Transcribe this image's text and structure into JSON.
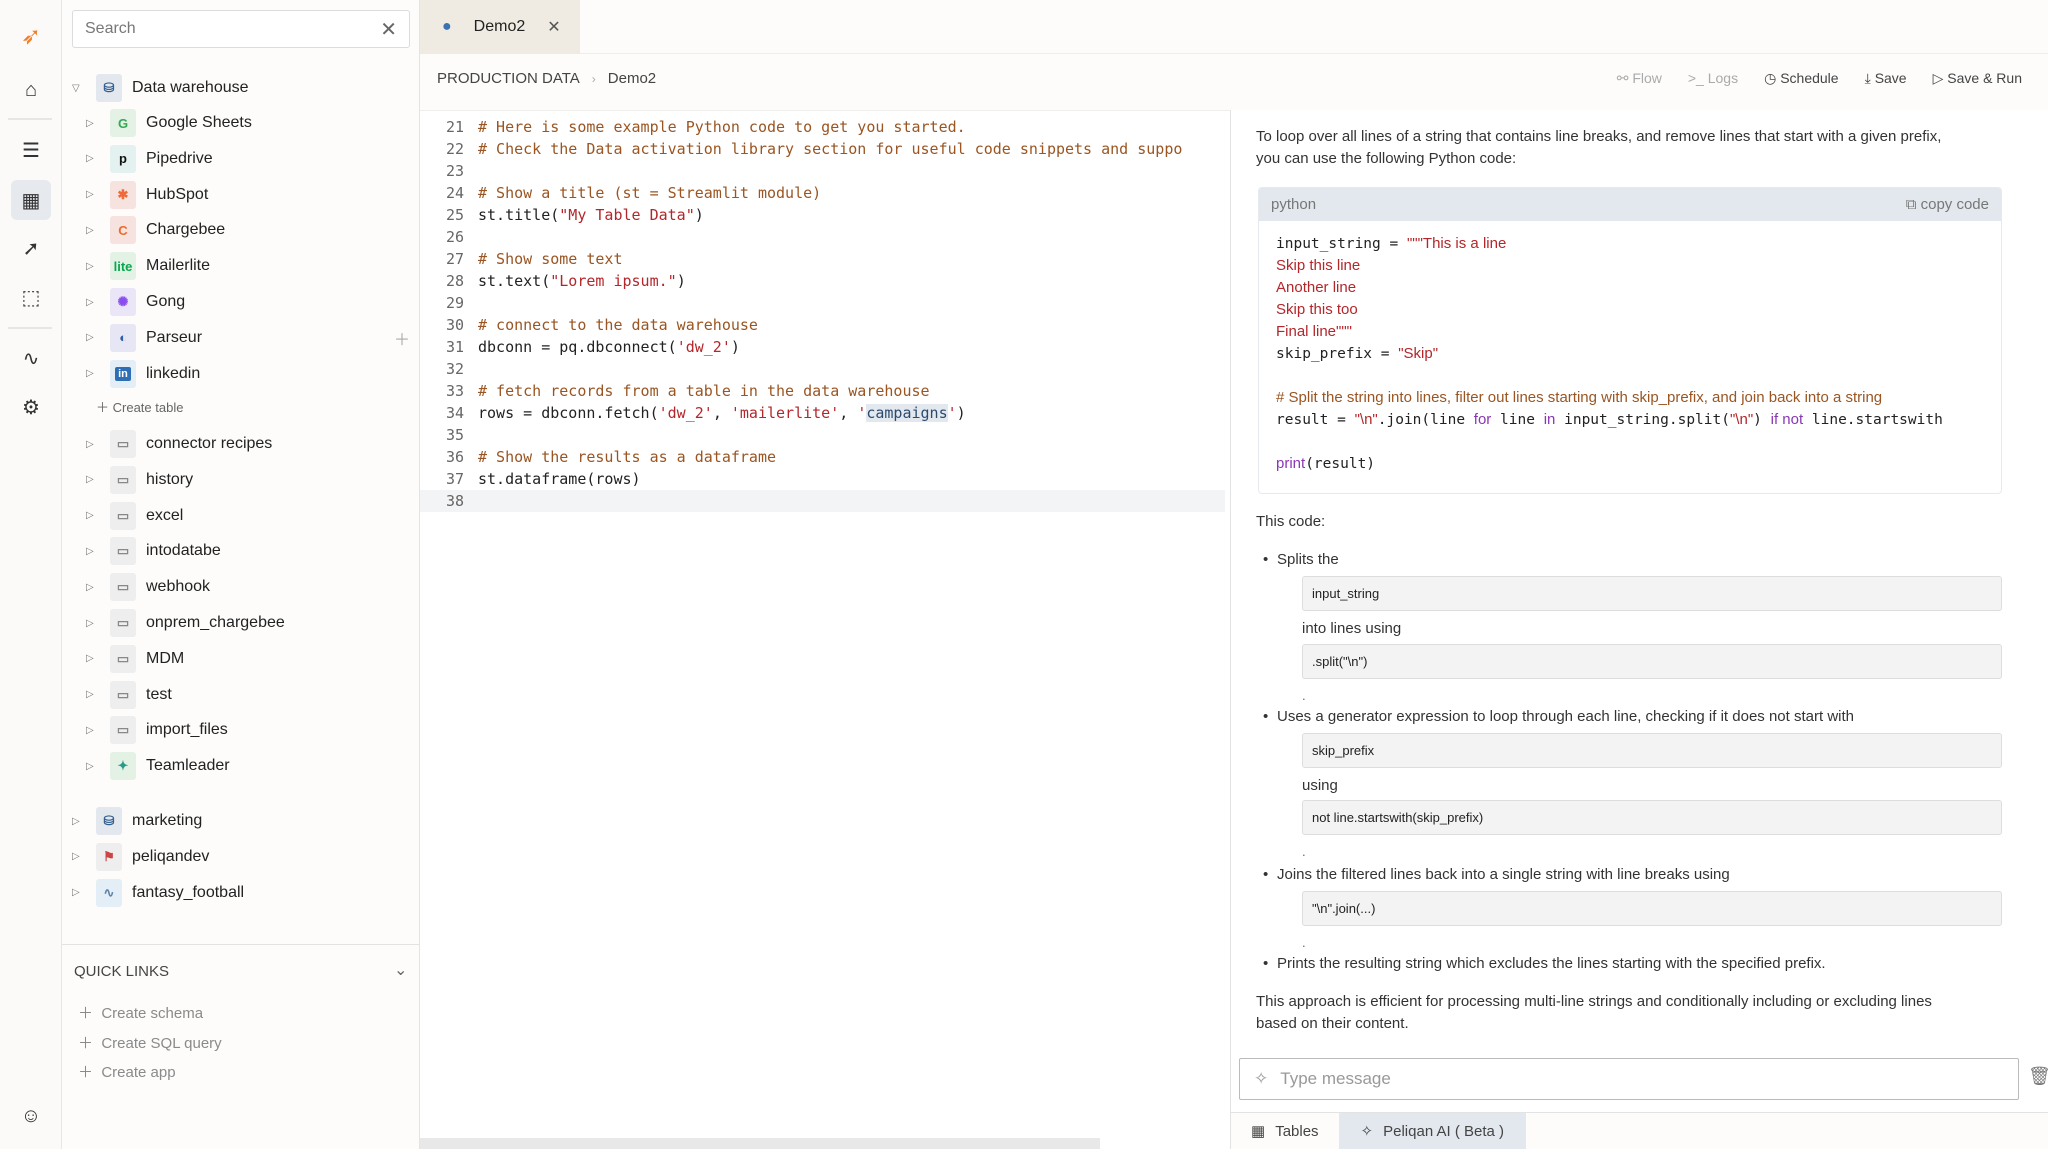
{
  "rail": {
    "items": [
      "logo",
      "home-icon",
      "database-icon",
      "table-icon",
      "rocket-icon",
      "box-icon",
      "activity-icon",
      "settings-icon",
      "user-icon"
    ],
    "active": "table-icon"
  },
  "sidebar": {
    "search_placeholder": "Search",
    "root": {
      "label": "Data warehouse",
      "children": [
        {
          "label": "Google Sheets",
          "icon": "G",
          "color": "#34a853",
          "bg": "#e4f2e6"
        },
        {
          "label": "Pipedrive",
          "icon": "p",
          "color": "#111",
          "bg": "#e4f1f1"
        },
        {
          "label": "HubSpot",
          "icon": "✱",
          "color": "#ef6a3a",
          "bg": "#f6e3df"
        },
        {
          "label": "Chargebee",
          "icon": "C",
          "color": "#f06a2a",
          "bg": "#f6e3df"
        },
        {
          "label": "Mailerlite",
          "icon": "lite",
          "color": "#09a84d",
          "bg": "#e4f2e6"
        },
        {
          "label": "Gong",
          "icon": "✺",
          "color": "#8a4df0",
          "bg": "#ebe6f7"
        },
        {
          "label": "Parseur",
          "icon": "◐",
          "color": "#2d5fa8",
          "bg": "#e6e6f4"
        },
        {
          "label": "linkedin",
          "icon": "in",
          "color": "#fff",
          "bg": "#e3eef6"
        }
      ],
      "create_table": "Create table",
      "folders": [
        "connector recipes",
        "history",
        "excel",
        "intodatabe",
        "webhook",
        "onprem_chargebee",
        "MDM",
        "test",
        "import_files"
      ],
      "teamleader": "Teamleader"
    },
    "others": [
      "marketing",
      "peliqandev",
      "fantasy_football"
    ],
    "quick_links": {
      "title": "QUICK LINKS",
      "items": [
        "Create schema",
        "Create SQL query",
        "Create app"
      ]
    }
  },
  "tab": {
    "label": "Demo2"
  },
  "breadcrumb": [
    "PRODUCTION DATA",
    "Demo2"
  ],
  "actions": {
    "flow": "Flow",
    "logs": "Logs",
    "schedule": "Schedule",
    "save": "Save",
    "save_run": "Save & Run"
  },
  "editor": {
    "lines": [
      {
        "n": "21",
        "seg": [
          [
            "c",
            "# Here is some example Python code to get you started."
          ]
        ]
      },
      {
        "n": "22",
        "seg": [
          [
            "c",
            "# Check the Data activation library section for useful code snippets and suppo"
          ]
        ]
      },
      {
        "n": "23",
        "seg": []
      },
      {
        "n": "24",
        "seg": [
          [
            "c",
            "# Show a title (st = Streamlit module)"
          ]
        ]
      },
      {
        "n": "25",
        "seg": [
          [
            "t",
            "st.title("
          ],
          [
            "s",
            "\"My Table Data\""
          ],
          [
            "t",
            ")"
          ]
        ]
      },
      {
        "n": "26",
        "seg": []
      },
      {
        "n": "27",
        "seg": [
          [
            "c",
            "# Show some text"
          ]
        ]
      },
      {
        "n": "28",
        "seg": [
          [
            "t",
            "st.text("
          ],
          [
            "s",
            "\"Lorem ipsum.\""
          ],
          [
            "t",
            ")"
          ]
        ]
      },
      {
        "n": "29",
        "seg": []
      },
      {
        "n": "30",
        "seg": [
          [
            "c",
            "# connect to the data warehouse"
          ]
        ]
      },
      {
        "n": "31",
        "seg": [
          [
            "t",
            "dbconn = pq.dbconnect("
          ],
          [
            "s",
            "'dw_2'"
          ],
          [
            "t",
            ")"
          ]
        ]
      },
      {
        "n": "32",
        "seg": []
      },
      {
        "n": "33",
        "seg": [
          [
            "c",
            "# fetch records from a table in the data warehouse"
          ]
        ]
      },
      {
        "n": "34",
        "seg": [
          [
            "t",
            "rows = dbconn.fetch("
          ],
          [
            "s",
            "'dw_2'"
          ],
          [
            "t",
            ", "
          ],
          [
            "s",
            "'mailerlite'"
          ],
          [
            "t",
            ", "
          ],
          [
            "s",
            "'"
          ],
          [
            "h",
            "campaigns"
          ],
          [
            "s",
            "'"
          ],
          [
            "t",
            ")"
          ]
        ]
      },
      {
        "n": "35",
        "seg": []
      },
      {
        "n": "36",
        "seg": [
          [
            "c",
            "# Show the results as a dataframe"
          ]
        ]
      },
      {
        "n": "37",
        "seg": [
          [
            "t",
            "st.dataframe(rows)"
          ]
        ]
      },
      {
        "n": "38",
        "seg": []
      }
    ]
  },
  "ai": {
    "intro": [
      "To loop over all lines of a string that contains line breaks, and remove lines that start with a given prefix,",
      "you can use the following Python code:"
    ],
    "code_lang": "python",
    "copy_label": "copy code",
    "code": [
      [
        [
          "m",
          "input_string = "
        ],
        [
          "s",
          "\"\"\"This is a line"
        ]
      ],
      [
        [
          "s",
          "Skip this line"
        ]
      ],
      [
        [
          "s",
          "Another line"
        ]
      ],
      [
        [
          "s",
          "Skip this too"
        ]
      ],
      [
        [
          "s",
          "Final line\"\"\""
        ]
      ],
      [
        [
          "m",
          "skip_prefix = "
        ],
        [
          "s",
          "\"Skip\""
        ]
      ],
      [],
      [
        [
          "c",
          "# Split the string into lines, filter out lines starting with skip_prefix, and join back into a string"
        ]
      ],
      [
        [
          "m",
          "result = "
        ],
        [
          "s",
          "\"\\n\""
        ],
        [
          "m",
          ".join(line "
        ],
        [
          "k",
          "for"
        ],
        [
          "m",
          " line "
        ],
        [
          "k",
          "in"
        ],
        [
          "m",
          " input_string.split("
        ],
        [
          "s",
          "\"\\n\""
        ],
        [
          "m",
          ") "
        ],
        [
          "k",
          "if not"
        ],
        [
          "m",
          " line.startswith"
        ]
      ],
      [],
      [
        [
          "k",
          "print"
        ],
        [
          "m",
          "(result)"
        ]
      ]
    ],
    "this_code": "This code:",
    "b1": "Splits the",
    "b1_code1": "input_string",
    "b1_mid": "into lines using",
    "b1_code2": ".split(\"\\n\")",
    "b2": "Uses a generator expression to loop through each line, checking if it does not start with",
    "b2_code1": "skip_prefix",
    "b2_mid": "using",
    "b2_code2": "not line.startswith(skip_prefix)",
    "b3": "Joins the filtered lines back into a single string with line breaks using",
    "b3_code": "\"\\n\".join(...)",
    "b4": "Prints the resulting string which excludes the lines starting with the specified prefix.",
    "dot": ".",
    "outro": [
      "This approach is efficient for processing multi-line strings and conditionally including or excluding lines",
      "based on their content."
    ],
    "input_placeholder": "Type message"
  },
  "bottom_tabs": {
    "tables": "Tables",
    "ai": "Peliqan AI ( Beta )",
    "active": "ai"
  },
  "colors": {
    "accent": "#f07f2e",
    "comment": "#9a5522",
    "string": "#b3262a",
    "keyword": "#8a37b5",
    "active_tab": "#e3e8ef"
  }
}
